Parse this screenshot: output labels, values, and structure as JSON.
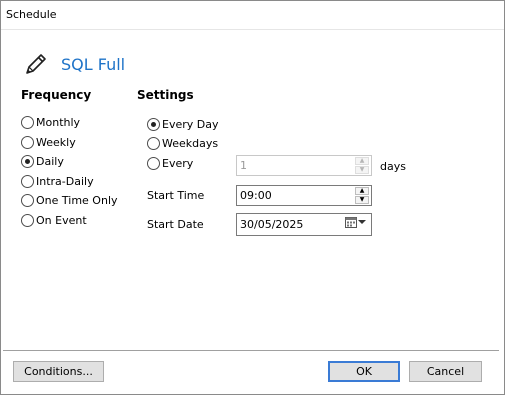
{
  "window": {
    "title": "Schedule"
  },
  "header": {
    "title": "SQL Full",
    "icon": "pencil-icon"
  },
  "frequency": {
    "title": "Frequency",
    "options": [
      {
        "label": "Monthly",
        "checked": false
      },
      {
        "label": "Weekly",
        "checked": false
      },
      {
        "label": "Daily",
        "checked": true
      },
      {
        "label": "Intra-Daily",
        "checked": false
      },
      {
        "label": "One Time Only",
        "checked": false
      },
      {
        "label": "On Event",
        "checked": false
      }
    ]
  },
  "settings": {
    "title": "Settings",
    "options": [
      {
        "label": "Every Day",
        "checked": true
      },
      {
        "label": "Weekdays",
        "checked": false
      },
      {
        "label": "Every",
        "checked": false
      }
    ],
    "every_value": "1",
    "every_unit": "days",
    "start_time_label": "Start Time",
    "start_time_value": "09:00",
    "start_date_label": "Start Date",
    "start_date_value": "30/05/2025"
  },
  "buttons": {
    "conditions": "Conditions...",
    "ok": "OK",
    "cancel": "Cancel"
  },
  "colors": {
    "accent": "#1e73c8",
    "default_button_border": "#3a7bd5"
  }
}
